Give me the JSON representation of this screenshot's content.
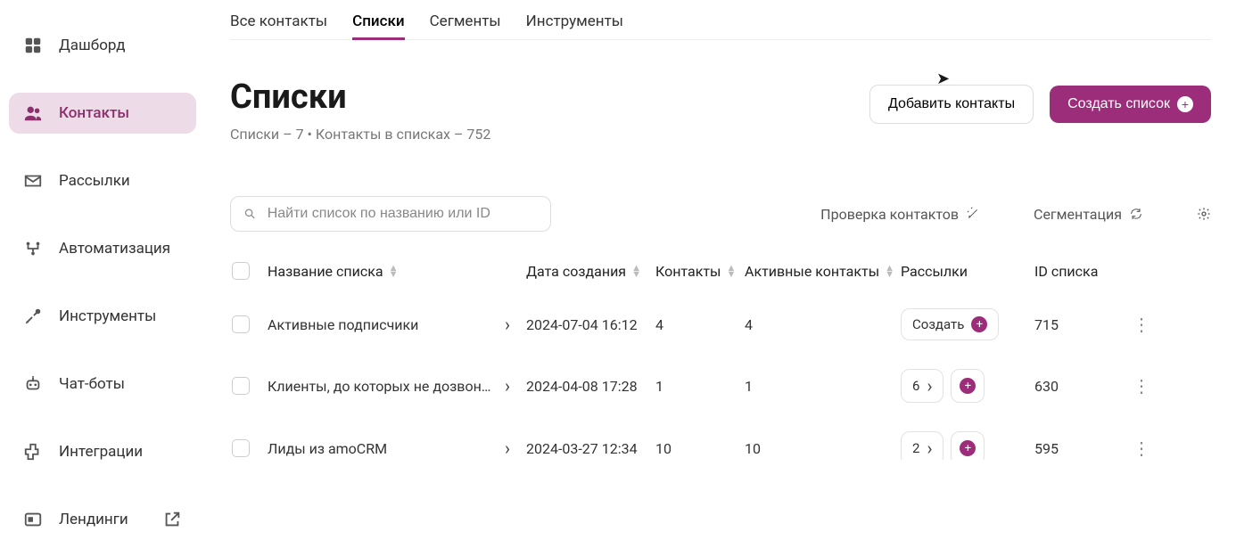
{
  "sidebar": {
    "items": [
      {
        "label": "Дашборд",
        "icon": "dashboard"
      },
      {
        "label": "Контакты",
        "icon": "people",
        "active": true
      },
      {
        "label": "Рассылки",
        "icon": "mail"
      },
      {
        "label": "Автоматизация",
        "icon": "automation"
      },
      {
        "label": "Инструменты",
        "icon": "tools"
      },
      {
        "label": "Чат-боты",
        "icon": "bot"
      },
      {
        "label": "Интеграции",
        "icon": "integrations"
      },
      {
        "label": "Лендинги",
        "icon": "landing",
        "external": true
      }
    ]
  },
  "tabs": [
    {
      "label": "Все контакты"
    },
    {
      "label": "Списки",
      "active": true
    },
    {
      "label": "Сегменты"
    },
    {
      "label": "Инструменты"
    }
  ],
  "header": {
    "title": "Списки",
    "subtitle": "Списки – 7 • Контакты в списках – 752",
    "add_contacts_label": "Добавить контакты",
    "create_list_label": "Создать список"
  },
  "toolbar": {
    "search_placeholder": "Найти список по названию или ID",
    "contact_check_label": "Проверка контактов",
    "segmentation_label": "Сегментация"
  },
  "table": {
    "columns": {
      "name": "Название списка",
      "date": "Дата создания",
      "contacts": "Контакты",
      "active": "Активные контакты",
      "mailings": "Рассылки",
      "id": "ID списка"
    },
    "create_label": "Создать",
    "rows": [
      {
        "name": "Активные подписчики",
        "date": "2024-07-04 16:12",
        "contacts": "4",
        "active": "4",
        "mailings": null,
        "id": "715"
      },
      {
        "name": "Клиенты, до которых не дозвонились",
        "date": "2024-04-08 17:28",
        "contacts": "1",
        "active": "1",
        "mailings": "6",
        "id": "630"
      },
      {
        "name": "Лиды из amoCRM",
        "date": "2024-03-27 12:34",
        "contacts": "10",
        "active": "10",
        "mailings": "2",
        "id": "595"
      }
    ]
  }
}
